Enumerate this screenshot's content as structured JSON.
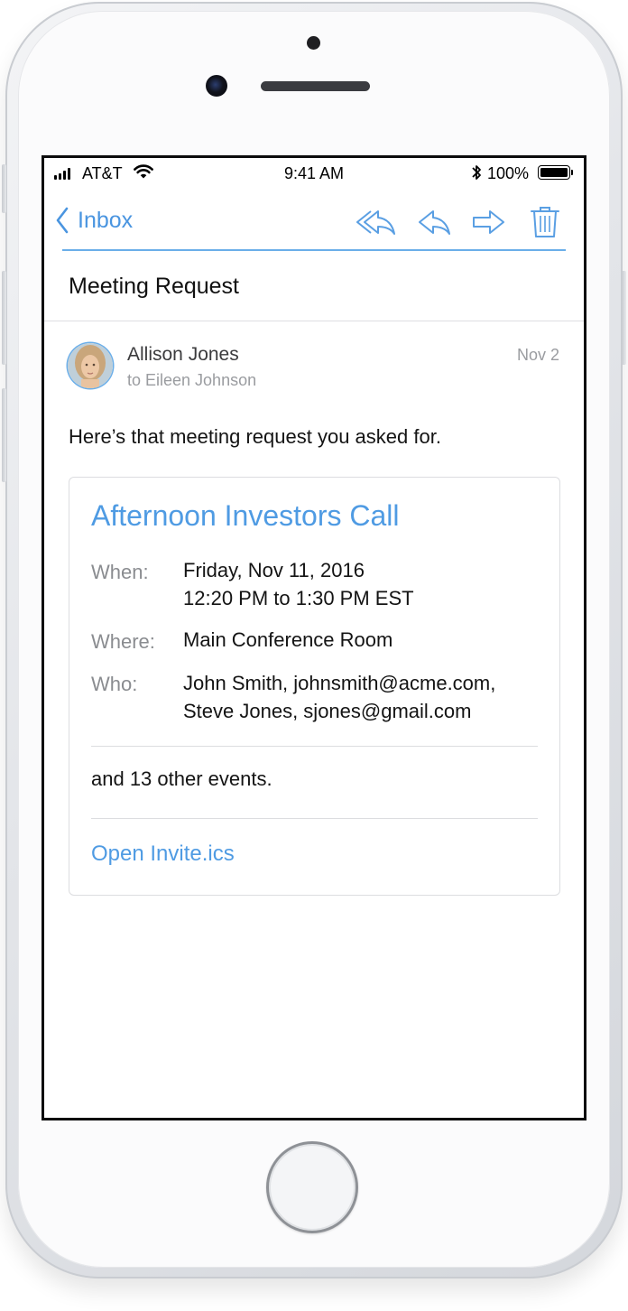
{
  "status_bar": {
    "carrier": "AT&T",
    "time": "9:41 AM",
    "battery_pct": "100%"
  },
  "nav": {
    "back_label": "Inbox",
    "icons": [
      "reply-all-icon",
      "reply-icon",
      "forward-icon",
      "trash-icon"
    ]
  },
  "email": {
    "subject": "Meeting Request",
    "sender": "Allison Jones",
    "recipient": "to Eileen Johnson",
    "date": "Nov 2",
    "body": "Here’s that meeting request you asked for."
  },
  "invite": {
    "title": "Afternoon Investors Call",
    "when_label": "When:",
    "when_line1": "Friday, Nov 11, 2016",
    "when_line2": "12:20 PM to 1:30 PM EST",
    "where_label": "Where:",
    "where_value": "Main Conference Room",
    "who_label": "Who:",
    "who_line1": "John Smith, johnsmith@acme.com,",
    "who_line2": "Steve Jones, sjones@gmail.com",
    "other_events": "and 13 other events.",
    "open_link": "Open Invite.ics"
  },
  "colors": {
    "accent": "#4f9be3",
    "secondary_text": "#9a9ca0",
    "divider": "#dcdde0"
  }
}
